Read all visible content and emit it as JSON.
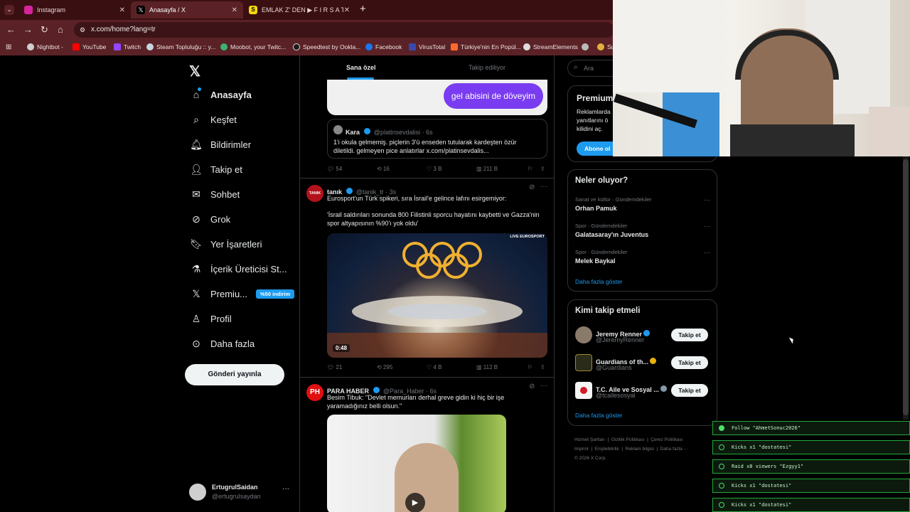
{
  "browser": {
    "tabs": [
      {
        "label": "Instagram",
        "color": "#d6249f"
      },
      {
        "label": "Anasayfa / X",
        "color": "#000000"
      },
      {
        "label": "EMLAK Z' DEN ▶ F I R S A T I",
        "color": "#f5d60a"
      }
    ],
    "url": "x.com/home?lang=tr",
    "bookmarks": [
      "Nightbot -",
      "YouTube",
      "Twitch",
      "Steam Topluluğu :: y...",
      "Moobot, your Twitc...",
      "Speedtest by Ookla...",
      "Facebook",
      "VirusTotal",
      "Türkiye'nin En Popül...",
      "StreamElements",
      "Su"
    ]
  },
  "sidebar": {
    "items": [
      {
        "label": "Anasayfa"
      },
      {
        "label": "Keşfet"
      },
      {
        "label": "Bildirimler"
      },
      {
        "label": "Takip et"
      },
      {
        "label": "Sohbet"
      },
      {
        "label": "Grok"
      },
      {
        "label": "Yer İşaretleri"
      },
      {
        "label": "İçerik Üreticisi St..."
      },
      {
        "label": "Premiu..."
      },
      {
        "label": "Profil"
      },
      {
        "label": "Daha fazla"
      }
    ],
    "premium_badge": "%50 indirim",
    "post_button": "Gönderi yayınla",
    "account": {
      "name": "ErtugrulSaidan",
      "handle": "@ertugrulsaydan"
    }
  },
  "feed": {
    "tabs": [
      "Sana özel",
      "Takip ediliyor"
    ],
    "bubble_text": "gel abisini de döveyim",
    "quote": {
      "name": "Kara",
      "handle": "@platinsevdalisi · 6s",
      "text": "1'i okula gelmemiş. piçlerin 3'ü enseden tutularak kardeşten özür diletildi. gelmeyen pice anlatırlar x.com/platinsevdalis..."
    },
    "tweet1_stats": {
      "replies": "54",
      "reposts": "16",
      "likes": "3 B",
      "views": "211 B"
    },
    "tweet2": {
      "avatar": "TANIK",
      "name": "tanık",
      "handle": "@tanik_tr · 3s",
      "line1": "Eurosport'un Türk spikeri, sıra İsrail'e gelince lafını esirgemiyor:",
      "line2": "'İsrail saldırıları sonunda 800 Filistinli sporcu hayatını kaybetti ve Gazza'nin spor altyapısının %90'ı yok oldu'",
      "video_time": "0:48",
      "badge": "LIVE EUROSPORT",
      "stats": {
        "replies": "21",
        "reposts": "295",
        "likes": "4 B",
        "views": "112 B"
      }
    },
    "tweet3": {
      "avatar": "PH",
      "name": "PARA HABER",
      "handle": "@Para_Haber · 6s",
      "text": "Besim Tibuk: \"Devlet memurları derhal greve gidin ki hiç bir işe yaramadığınız belli olsun.\""
    }
  },
  "right": {
    "search_placeholder": "Ara",
    "premium": {
      "title": "Premium",
      "text": "Reklamlarda yanıtlarını ö kilidini aç.",
      "button": "Abone ol"
    },
    "trends_title": "Neler oluyor?",
    "trends": [
      {
        "category": "Sanat ve kültür · Gündemdekiler",
        "title": "Orhan Pamuk"
      },
      {
        "category": "Spor · Gündemdekiler",
        "title": "Galatasaray'ın Juventus"
      },
      {
        "category": "Spor · Gündemdekiler",
        "title": "Melek Baykal"
      }
    ],
    "show_more": "Daha fazla göster",
    "who_title": "Kimi takip etmeli",
    "who": [
      {
        "name": "Jeremy Renner",
        "handle": "@JeremyRenner",
        "button": "Takip et"
      },
      {
        "name": "Guardians of th...",
        "handle": "@Guardians",
        "button": "Takip et"
      },
      {
        "name": "T.C. Aile ve Sosyal ...",
        "handle": "@tcailesosyal",
        "button": "Takip et"
      }
    ],
    "who_more": "Daha fazla göster",
    "footer": [
      "Hizmet Şartları",
      "Gizlilik Politikası",
      "Çerez Politikası",
      "Imprint",
      "Erişilebilirlik",
      "Reklam bilgisi",
      "Daha fazla ···",
      "© 2026 X Corp."
    ]
  },
  "overlay": {
    "events": [
      "Follow \"AhmetSonuc2026\"",
      "Kicks x1 \"dostatesi\"",
      "Raid x8 viewers \"Ezgyy1\"",
      "Kicks x1 \"dostatesi\"",
      "Kicks x1 \"dostatesi\""
    ]
  }
}
